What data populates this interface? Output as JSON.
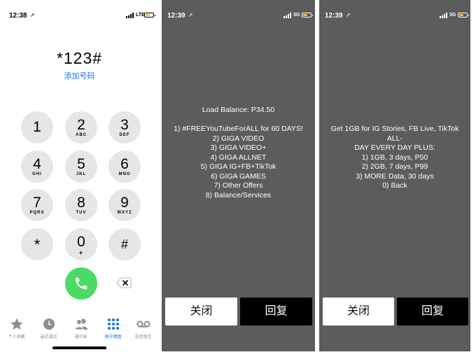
{
  "panel1": {
    "status": {
      "time": "12:38",
      "network": "LTE"
    },
    "number": "*123#",
    "add_number": "添加号码",
    "keys": [
      {
        "digit": "1",
        "letters": ""
      },
      {
        "digit": "2",
        "letters": "ABC"
      },
      {
        "digit": "3",
        "letters": "DEF"
      },
      {
        "digit": "4",
        "letters": "GHI"
      },
      {
        "digit": "5",
        "letters": "JKL"
      },
      {
        "digit": "6",
        "letters": "MNO"
      },
      {
        "digit": "7",
        "letters": "PQRS"
      },
      {
        "digit": "8",
        "letters": "TUV"
      },
      {
        "digit": "9",
        "letters": "WXYZ"
      },
      {
        "digit": "*",
        "letters": ""
      },
      {
        "digit": "0",
        "letters": "+"
      },
      {
        "digit": "#",
        "letters": ""
      }
    ],
    "icons": {
      "call": "phone-icon",
      "delete": "delete-backspace-icon"
    },
    "tabs": [
      {
        "label": "个人收藏",
        "icon": "star-icon"
      },
      {
        "label": "最近通话",
        "icon": "clock-icon"
      },
      {
        "label": "通讯录",
        "icon": "contacts-icon"
      },
      {
        "label": "拨号键盘",
        "icon": "keypad-icon",
        "active": true
      },
      {
        "label": "语音留言",
        "icon": "voicemail-icon"
      }
    ],
    "colors": {
      "accent": "#1a73e8",
      "call": "#4cd964",
      "key": "#e6e6e6"
    }
  },
  "panel2": {
    "status": {
      "time": "12:39",
      "network": "3G"
    },
    "message": "Load Balance: P34.50\n\n1) #FREEYouTubeForALL for 60 DAYS!\n2) GIGA VIDEO\n3) GIGA VIDEO+\n4) GIGA ALLNET\n5) GIGA IG+FB+TikTok\n6) GIGA GAMES\n7) Other Offers\n8) Balance/Services",
    "close_label": "关闭",
    "reply_label": "回复"
  },
  "panel3": {
    "status": {
      "time": "12:39",
      "network": "3G"
    },
    "message": "Get 1GB for IG Stories, FB Live, TikTok ALL-\nDAY EVERY DAY PLUS:\n1) 1GB, 3 days, P50\n2) 2GB, 7 days, P99\n3) MORE Data, 30 days\n0) Back",
    "close_label": "关闭",
    "reply_label": "回复"
  },
  "colors": {
    "ussd_background": "#5c5c5c",
    "battery": "#f4c21b"
  }
}
